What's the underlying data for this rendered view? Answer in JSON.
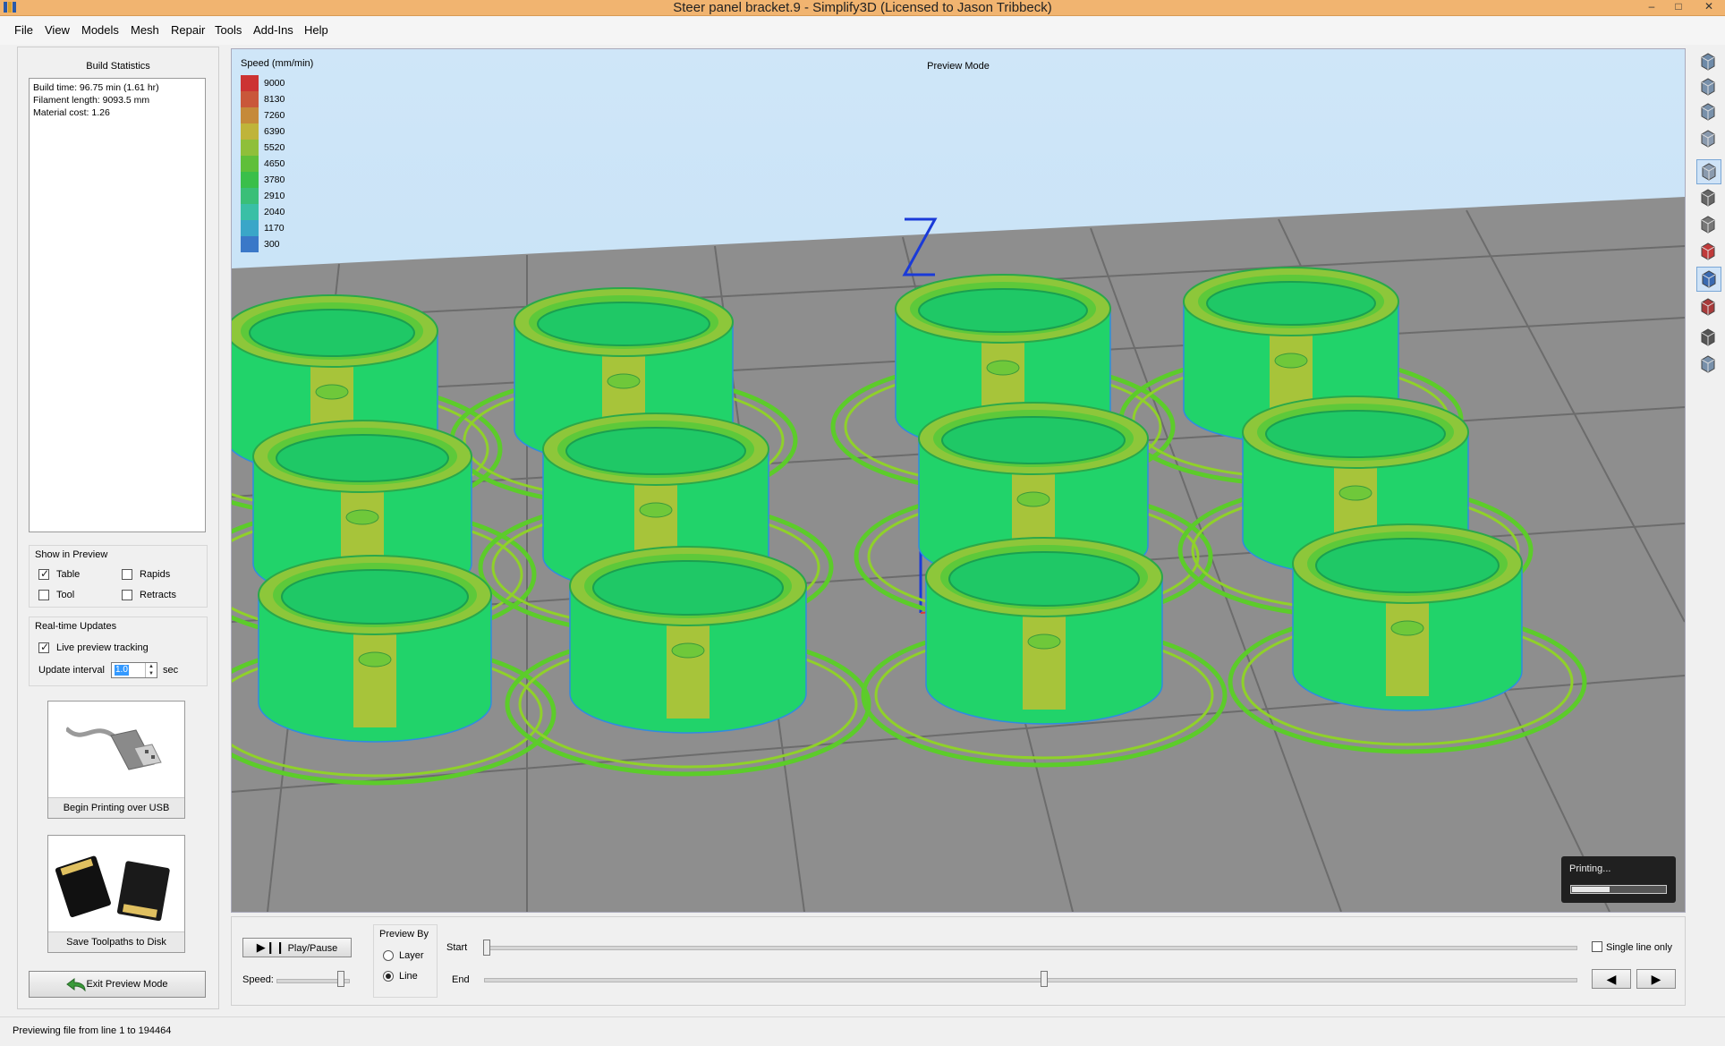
{
  "window": {
    "title": "Steer panel bracket.9 - Simplify3D (Licensed to Jason Tribbeck)",
    "minimize": "–",
    "maximize": "□",
    "close": "✕"
  },
  "menu": [
    "File",
    "View",
    "Models",
    "Mesh",
    "Repair",
    "Tools",
    "Add-Ins",
    "Help"
  ],
  "left_panel": {
    "build_stats_title": "Build Statistics",
    "stats": [
      "Build time: 96.75 min (1.61 hr)",
      "Filament length: 9093.5 mm",
      "Material cost: 1.26"
    ],
    "show_in_preview": {
      "title": "Show in Preview",
      "table": {
        "label": "Table",
        "checked": true
      },
      "rapids": {
        "label": "Rapids",
        "checked": false
      },
      "tool": {
        "label": "Tool",
        "checked": false
      },
      "retracts": {
        "label": "Retracts",
        "checked": false
      }
    },
    "realtime": {
      "title": "Real-time Updates",
      "live_tracking_label": "Live preview tracking",
      "live_tracking_checked": true,
      "interval_label": "Update interval",
      "interval_value": "1.0",
      "interval_unit": "sec"
    },
    "usb_button": "Begin Printing over USB",
    "save_button": "Save Toolpaths to Disk",
    "exit_button": "Exit Preview Mode"
  },
  "viewport": {
    "mode_label": "Preview Mode",
    "legend_title": "Speed (mm/min)",
    "legend": [
      {
        "value": "9000",
        "color": "#cc3333"
      },
      {
        "value": "8130",
        "color": "#c9573a"
      },
      {
        "value": "7260",
        "color": "#c58a3a"
      },
      {
        "value": "6390",
        "color": "#bfb43a"
      },
      {
        "value": "5520",
        "color": "#8fbf3a"
      },
      {
        "value": "4650",
        "color": "#5fbf3a"
      },
      {
        "value": "3780",
        "color": "#3abf4a"
      },
      {
        "value": "2910",
        "color": "#3abf78"
      },
      {
        "value": "2040",
        "color": "#3abfa6"
      },
      {
        "value": "1170",
        "color": "#3aa6c8"
      },
      {
        "value": "300",
        "color": "#3a78c8"
      }
    ],
    "axis_label": "Z",
    "printing_label": "Printing...",
    "printing_progress": 0.4
  },
  "bottom": {
    "play_label": "Play/Pause",
    "speed_label": "Speed:",
    "preview_by_title": "Preview By",
    "layer_label": "Layer",
    "line_label": "Line",
    "preview_by_selected": "Line",
    "start_label": "Start",
    "end_label": "End",
    "single_line_label": "Single line only",
    "single_line_checked": false
  },
  "right_toolbar": [
    "iso-view-icon",
    "front-view-icon",
    "top-view-icon",
    "side-view-icon",
    "solid-view-icon",
    "wireframe-view-icon",
    "points-view-icon",
    "axes-icon",
    "preview-icon",
    "cross-section-icon",
    "settings-gear-icon",
    "tools-icon"
  ],
  "status": "Previewing file from line 1 to 194464"
}
